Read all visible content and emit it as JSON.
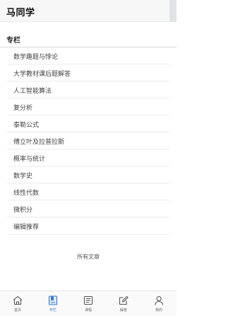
{
  "header": {
    "title": "马同学"
  },
  "section": {
    "title": "专栏"
  },
  "list": {
    "items": [
      "数学趣题与悖论",
      "大学教材课后题解答",
      "人工智能算法",
      "复分析",
      "泰勒公式",
      "傅立叶及拉普拉斯",
      "概率与统计",
      "数学史",
      "线性代数",
      "微积分",
      "编辑推荐"
    ],
    "all_articles": "所有文章"
  },
  "nav": {
    "items": [
      {
        "label": "首页",
        "icon": "home-icon"
      },
      {
        "label": "专栏",
        "icon": "column-icon"
      },
      {
        "label": "课程",
        "icon": "course-icon"
      },
      {
        "label": "解答",
        "icon": "answer-icon"
      },
      {
        "label": "我的",
        "icon": "profile-icon"
      }
    ],
    "active_index": 1,
    "active_color": "#3a78c9",
    "inactive_color": "#555555"
  }
}
